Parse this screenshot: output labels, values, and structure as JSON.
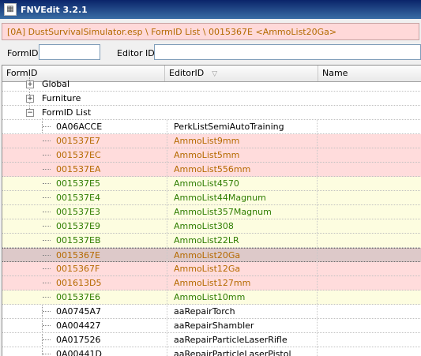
{
  "window": {
    "title": "FNVEdit 3.2.1",
    "icon": "app-icon"
  },
  "path": "[0A] DustSurvivalSimulator.esp \\ FormID List \\ 0015367E <AmmoList20Ga>",
  "filters": {
    "formid_label": "FormID",
    "formid_value": "",
    "editorid_label": "Editor ID",
    "editorid_value": ""
  },
  "grid": {
    "columns": {
      "formid": "FormID",
      "editorid": "EditorID",
      "name": "Name"
    },
    "groups": [
      {
        "label": "Global",
        "expander": "+"
      },
      {
        "label": "Furniture",
        "expander": "+"
      },
      {
        "label": "FormID List",
        "expander": "−"
      }
    ],
    "rows": [
      {
        "formid": "0A06ACCE",
        "editorid": "PerkListSemiAutoTraining"
      },
      {
        "formid": "001537E7",
        "editorid": "AmmoList9mm"
      },
      {
        "formid": "001537EC",
        "editorid": "AmmoList5mm"
      },
      {
        "formid": "001537EA",
        "editorid": "AmmoList556mm"
      },
      {
        "formid": "001537E5",
        "editorid": "AmmoList4570"
      },
      {
        "formid": "001537E4",
        "editorid": "AmmoList44Magnum"
      },
      {
        "formid": "001537E3",
        "editorid": "AmmoList357Magnum"
      },
      {
        "formid": "001537E9",
        "editorid": "AmmoList308"
      },
      {
        "formid": "001537EB",
        "editorid": "AmmoList22LR"
      },
      {
        "formid": "0015367E",
        "editorid": "AmmoList20Ga"
      },
      {
        "formid": "0015367F",
        "editorid": "AmmoList12Ga"
      },
      {
        "formid": "001613D5",
        "editorid": "AmmoList127mm"
      },
      {
        "formid": "001537E6",
        "editorid": "AmmoList10mm"
      },
      {
        "formid": "0A0745A7",
        "editorid": "aaRepairTorch"
      },
      {
        "formid": "0A004427",
        "editorid": "aaRepairShambler"
      },
      {
        "formid": "0A017526",
        "editorid": "aaRepairParticleLaserRifle"
      },
      {
        "formid": "0A00441D",
        "editorid": "aaRepairParticleLaserPistol"
      }
    ]
  },
  "colors": {
    "conflict_bg": "#ffdcdc",
    "override_bg": "#fdfde0",
    "selected_bg": "#ddc9c9",
    "orange_text": "#b56a00",
    "green_text": "#2e7d00"
  }
}
